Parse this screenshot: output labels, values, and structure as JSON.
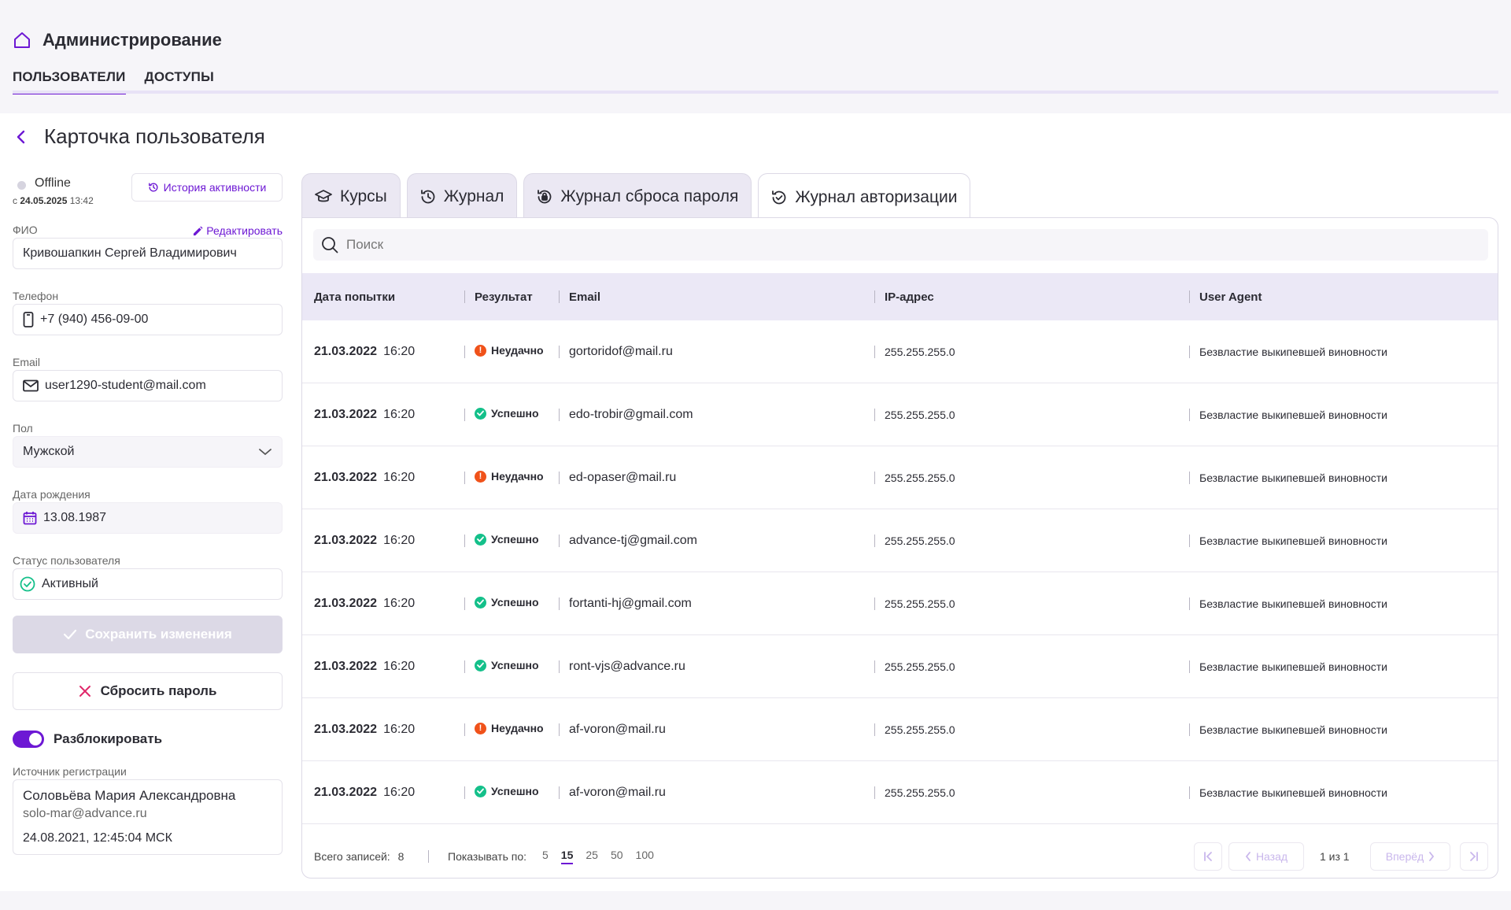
{
  "header": {
    "title": "Администрирование",
    "tabs": [
      {
        "label": "ПОЛЬЗОВАТЕЛИ",
        "active": true
      },
      {
        "label": "ДОСТУПЫ",
        "active": false
      }
    ]
  },
  "page": {
    "title": "Карточка пользователя"
  },
  "profile": {
    "status": "Offline",
    "since_prefix": "с",
    "since_date": "24.05.2025",
    "since_time": "13:42",
    "history_button": "История активности",
    "fio_label": "ФИО",
    "edit_label": "Редактировать",
    "fio_value": "Кривошапкин Сергей Владимирович",
    "phone_label": "Телефон",
    "phone_value": "+7 (940) 456-09-00",
    "email_label": "Email",
    "email_value": "user1290-student@mail.com",
    "gender_label": "Пол",
    "gender_value": "Мужской",
    "birth_label": "Дата рождения",
    "birth_value": "13.08.1987",
    "user_status_label": "Статус пользователя",
    "user_status_value": "Активный",
    "save_button": "Сохранить изменения",
    "reset_button": "Сбросить пароль",
    "unblock_label": "Разблокировать",
    "source_label": "Источник регистрации",
    "source_name": "Соловьёва Мария Александровна",
    "source_email": "solo-mar@advance.ru",
    "source_date": "24.08.2021, 12:45:04 МСК"
  },
  "tabs": [
    {
      "label": "Курсы",
      "icon": "graduation-cap-icon"
    },
    {
      "label": "Журнал",
      "icon": "history-icon"
    },
    {
      "label": "Журнал сброса пароля",
      "icon": "lock-reset-icon"
    },
    {
      "label": "Журнал авторизации",
      "icon": "check-history-icon",
      "active": true
    }
  ],
  "search": {
    "placeholder": "Поиск"
  },
  "table": {
    "columns": [
      "Дата попытки",
      "Результат",
      "Email",
      "IP-адрес",
      "User Agent"
    ],
    "rows": [
      {
        "date": "21.03.2022",
        "time": "16:20",
        "result": "Неудачно",
        "ok": false,
        "email": "gortoridof@mail.ru",
        "ip": "255.255.255.0",
        "ua": "Безвластие выкипевшей виновности"
      },
      {
        "date": "21.03.2022",
        "time": "16:20",
        "result": "Успешно",
        "ok": true,
        "email": "edo-trobir@gmail.com",
        "ip": "255.255.255.0",
        "ua": "Безвластие выкипевшей виновности"
      },
      {
        "date": "21.03.2022",
        "time": "16:20",
        "result": "Неудачно",
        "ok": false,
        "email": "ed-opaser@mail.ru",
        "ip": "255.255.255.0",
        "ua": "Безвластие выкипевшей виновности"
      },
      {
        "date": "21.03.2022",
        "time": "16:20",
        "result": "Успешно",
        "ok": true,
        "email": "advance-tj@gmail.com",
        "ip": "255.255.255.0",
        "ua": "Безвластие выкипевшей виновности"
      },
      {
        "date": "21.03.2022",
        "time": "16:20",
        "result": "Успешно",
        "ok": true,
        "email": "fortanti-hj@gmail.com",
        "ip": "255.255.255.0",
        "ua": "Безвластие выкипевшей виновности"
      },
      {
        "date": "21.03.2022",
        "time": "16:20",
        "result": "Успешно",
        "ok": true,
        "email": "ront-vjs@advance.ru",
        "ip": "255.255.255.0",
        "ua": "Безвластие выкипевшей виновности"
      },
      {
        "date": "21.03.2022",
        "time": "16:20",
        "result": "Неудачно",
        "ok": false,
        "email": "af-voron@mail.ru",
        "ip": "255.255.255.0",
        "ua": "Безвластие выкипевшей виновности"
      },
      {
        "date": "21.03.2022",
        "time": "16:20",
        "result": "Успешно",
        "ok": true,
        "email": "af-voron@mail.ru",
        "ip": "255.255.255.0",
        "ua": "Безвластие выкипевшей виновности"
      }
    ]
  },
  "footer": {
    "total_label": "Всего записей:",
    "total_value": "8",
    "per_page_label": "Показывать по:",
    "per_page_options": [
      "5",
      "15",
      "25",
      "50",
      "100"
    ],
    "per_page_selected": "15",
    "prev_label": "Назад",
    "next_label": "Вперёд",
    "page_info": "1 из 1"
  },
  "colors": {
    "accent": "#6d18d4",
    "success": "#14c08a",
    "error": "#f0521a"
  }
}
